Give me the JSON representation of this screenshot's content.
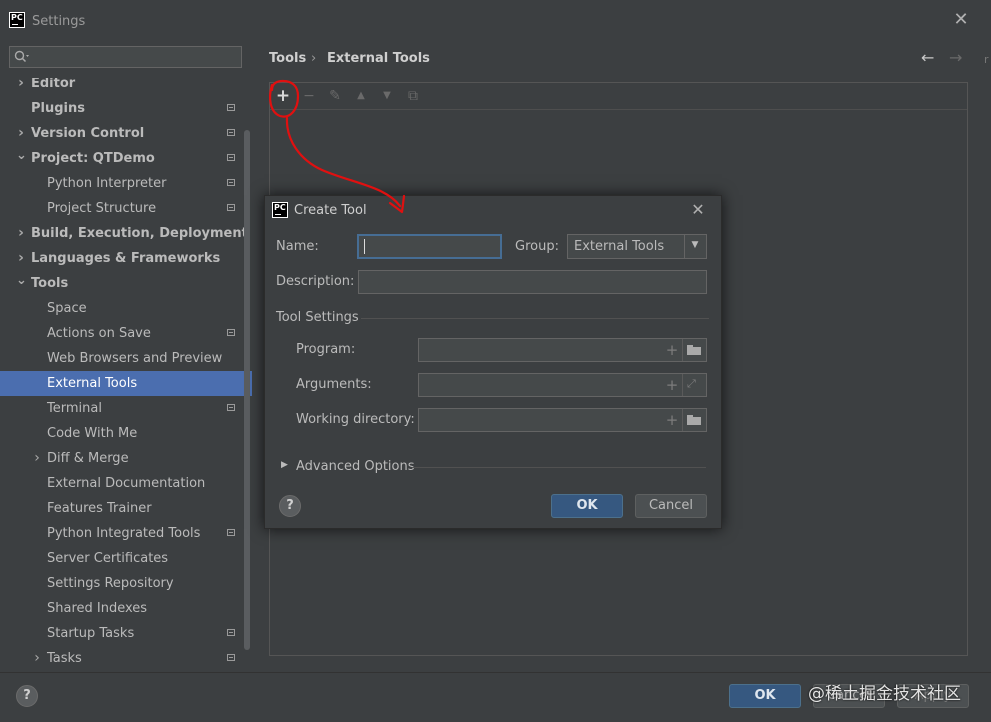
{
  "window": {
    "app_logo": "PC",
    "title": "Settings",
    "close_icon": "close-icon"
  },
  "sidebar": {
    "search": {
      "value": "",
      "placeholder": ""
    },
    "items": [
      {
        "label": "Editor",
        "bold": true,
        "arrow": "collapsed",
        "badge": false,
        "indent": 0
      },
      {
        "label": "Plugins",
        "bold": true,
        "arrow": "none",
        "badge": true,
        "indent": 0
      },
      {
        "label": "Version Control",
        "bold": true,
        "arrow": "collapsed",
        "badge": true,
        "indent": 0
      },
      {
        "label": "Project: QTDemo",
        "bold": true,
        "arrow": "expanded",
        "badge": true,
        "indent": 0
      },
      {
        "label": "Python Interpreter",
        "bold": false,
        "arrow": "none",
        "badge": true,
        "indent": 1
      },
      {
        "label": "Project Structure",
        "bold": false,
        "arrow": "none",
        "badge": true,
        "indent": 1
      },
      {
        "label": "Build, Execution, Deployment",
        "bold": true,
        "arrow": "collapsed",
        "badge": false,
        "indent": 0
      },
      {
        "label": "Languages & Frameworks",
        "bold": true,
        "arrow": "collapsed",
        "badge": false,
        "indent": 0
      },
      {
        "label": "Tools",
        "bold": true,
        "arrow": "expanded",
        "badge": false,
        "indent": 0
      },
      {
        "label": "Space",
        "bold": false,
        "arrow": "none",
        "badge": false,
        "indent": 1
      },
      {
        "label": "Actions on Save",
        "bold": false,
        "arrow": "none",
        "badge": true,
        "indent": 1
      },
      {
        "label": "Web Browsers and Preview",
        "bold": false,
        "arrow": "none",
        "badge": false,
        "indent": 1
      },
      {
        "label": "External Tools",
        "bold": false,
        "arrow": "none",
        "badge": false,
        "indent": 1,
        "selected": true
      },
      {
        "label": "Terminal",
        "bold": false,
        "arrow": "none",
        "badge": true,
        "indent": 1
      },
      {
        "label": "Code With Me",
        "bold": false,
        "arrow": "none",
        "badge": false,
        "indent": 1
      },
      {
        "label": "Diff & Merge",
        "bold": false,
        "arrow": "collapsed",
        "badge": false,
        "indent": 1
      },
      {
        "label": "External Documentation",
        "bold": false,
        "arrow": "none",
        "badge": false,
        "indent": 1
      },
      {
        "label": "Features Trainer",
        "bold": false,
        "arrow": "none",
        "badge": false,
        "indent": 1
      },
      {
        "label": "Python Integrated Tools",
        "bold": false,
        "arrow": "none",
        "badge": true,
        "indent": 1
      },
      {
        "label": "Server Certificates",
        "bold": false,
        "arrow": "none",
        "badge": false,
        "indent": 1
      },
      {
        "label": "Settings Repository",
        "bold": false,
        "arrow": "none",
        "badge": false,
        "indent": 1
      },
      {
        "label": "Shared Indexes",
        "bold": false,
        "arrow": "none",
        "badge": false,
        "indent": 1
      },
      {
        "label": "Startup Tasks",
        "bold": false,
        "arrow": "none",
        "badge": true,
        "indent": 1
      },
      {
        "label": "Tasks",
        "bold": false,
        "arrow": "collapsed",
        "badge": true,
        "indent": 1
      }
    ]
  },
  "content": {
    "breadcrumb": {
      "root": "Tools",
      "separator": "›",
      "current": "External Tools"
    },
    "nav": {
      "back_icon": "←",
      "forward_icon": "→",
      "edge_text": "r"
    },
    "toolbar": {
      "add": "+",
      "remove": "−",
      "edit": "✎",
      "move_up": "▲",
      "move_down": "▼",
      "copy": "⧉"
    }
  },
  "dialog": {
    "logo": "PC",
    "title": "Create Tool",
    "close": "✕",
    "name_label": "Name:",
    "name_value": "",
    "group_label": "Group:",
    "group_value": "External Tools",
    "group_arrow": "▼",
    "description_label": "Description:",
    "description_value": "",
    "tool_settings_label": "Tool Settings",
    "program_label": "Program:",
    "program_value": "",
    "arguments_label": "Arguments:",
    "arguments_value": "",
    "working_directory_label": "Working directory:",
    "working_directory_value": "",
    "plus": "+",
    "expand": "⤢",
    "advanced_arrow": "▶",
    "advanced_label": "Advanced Options",
    "help": "?",
    "ok": "OK",
    "cancel": "Cancel"
  },
  "footer": {
    "help": "?",
    "ok": "OK",
    "cancel": "Cancel",
    "apply": "Apply"
  },
  "watermark": "@稀土掘金技术社区",
  "annotation_color": "#e01010"
}
